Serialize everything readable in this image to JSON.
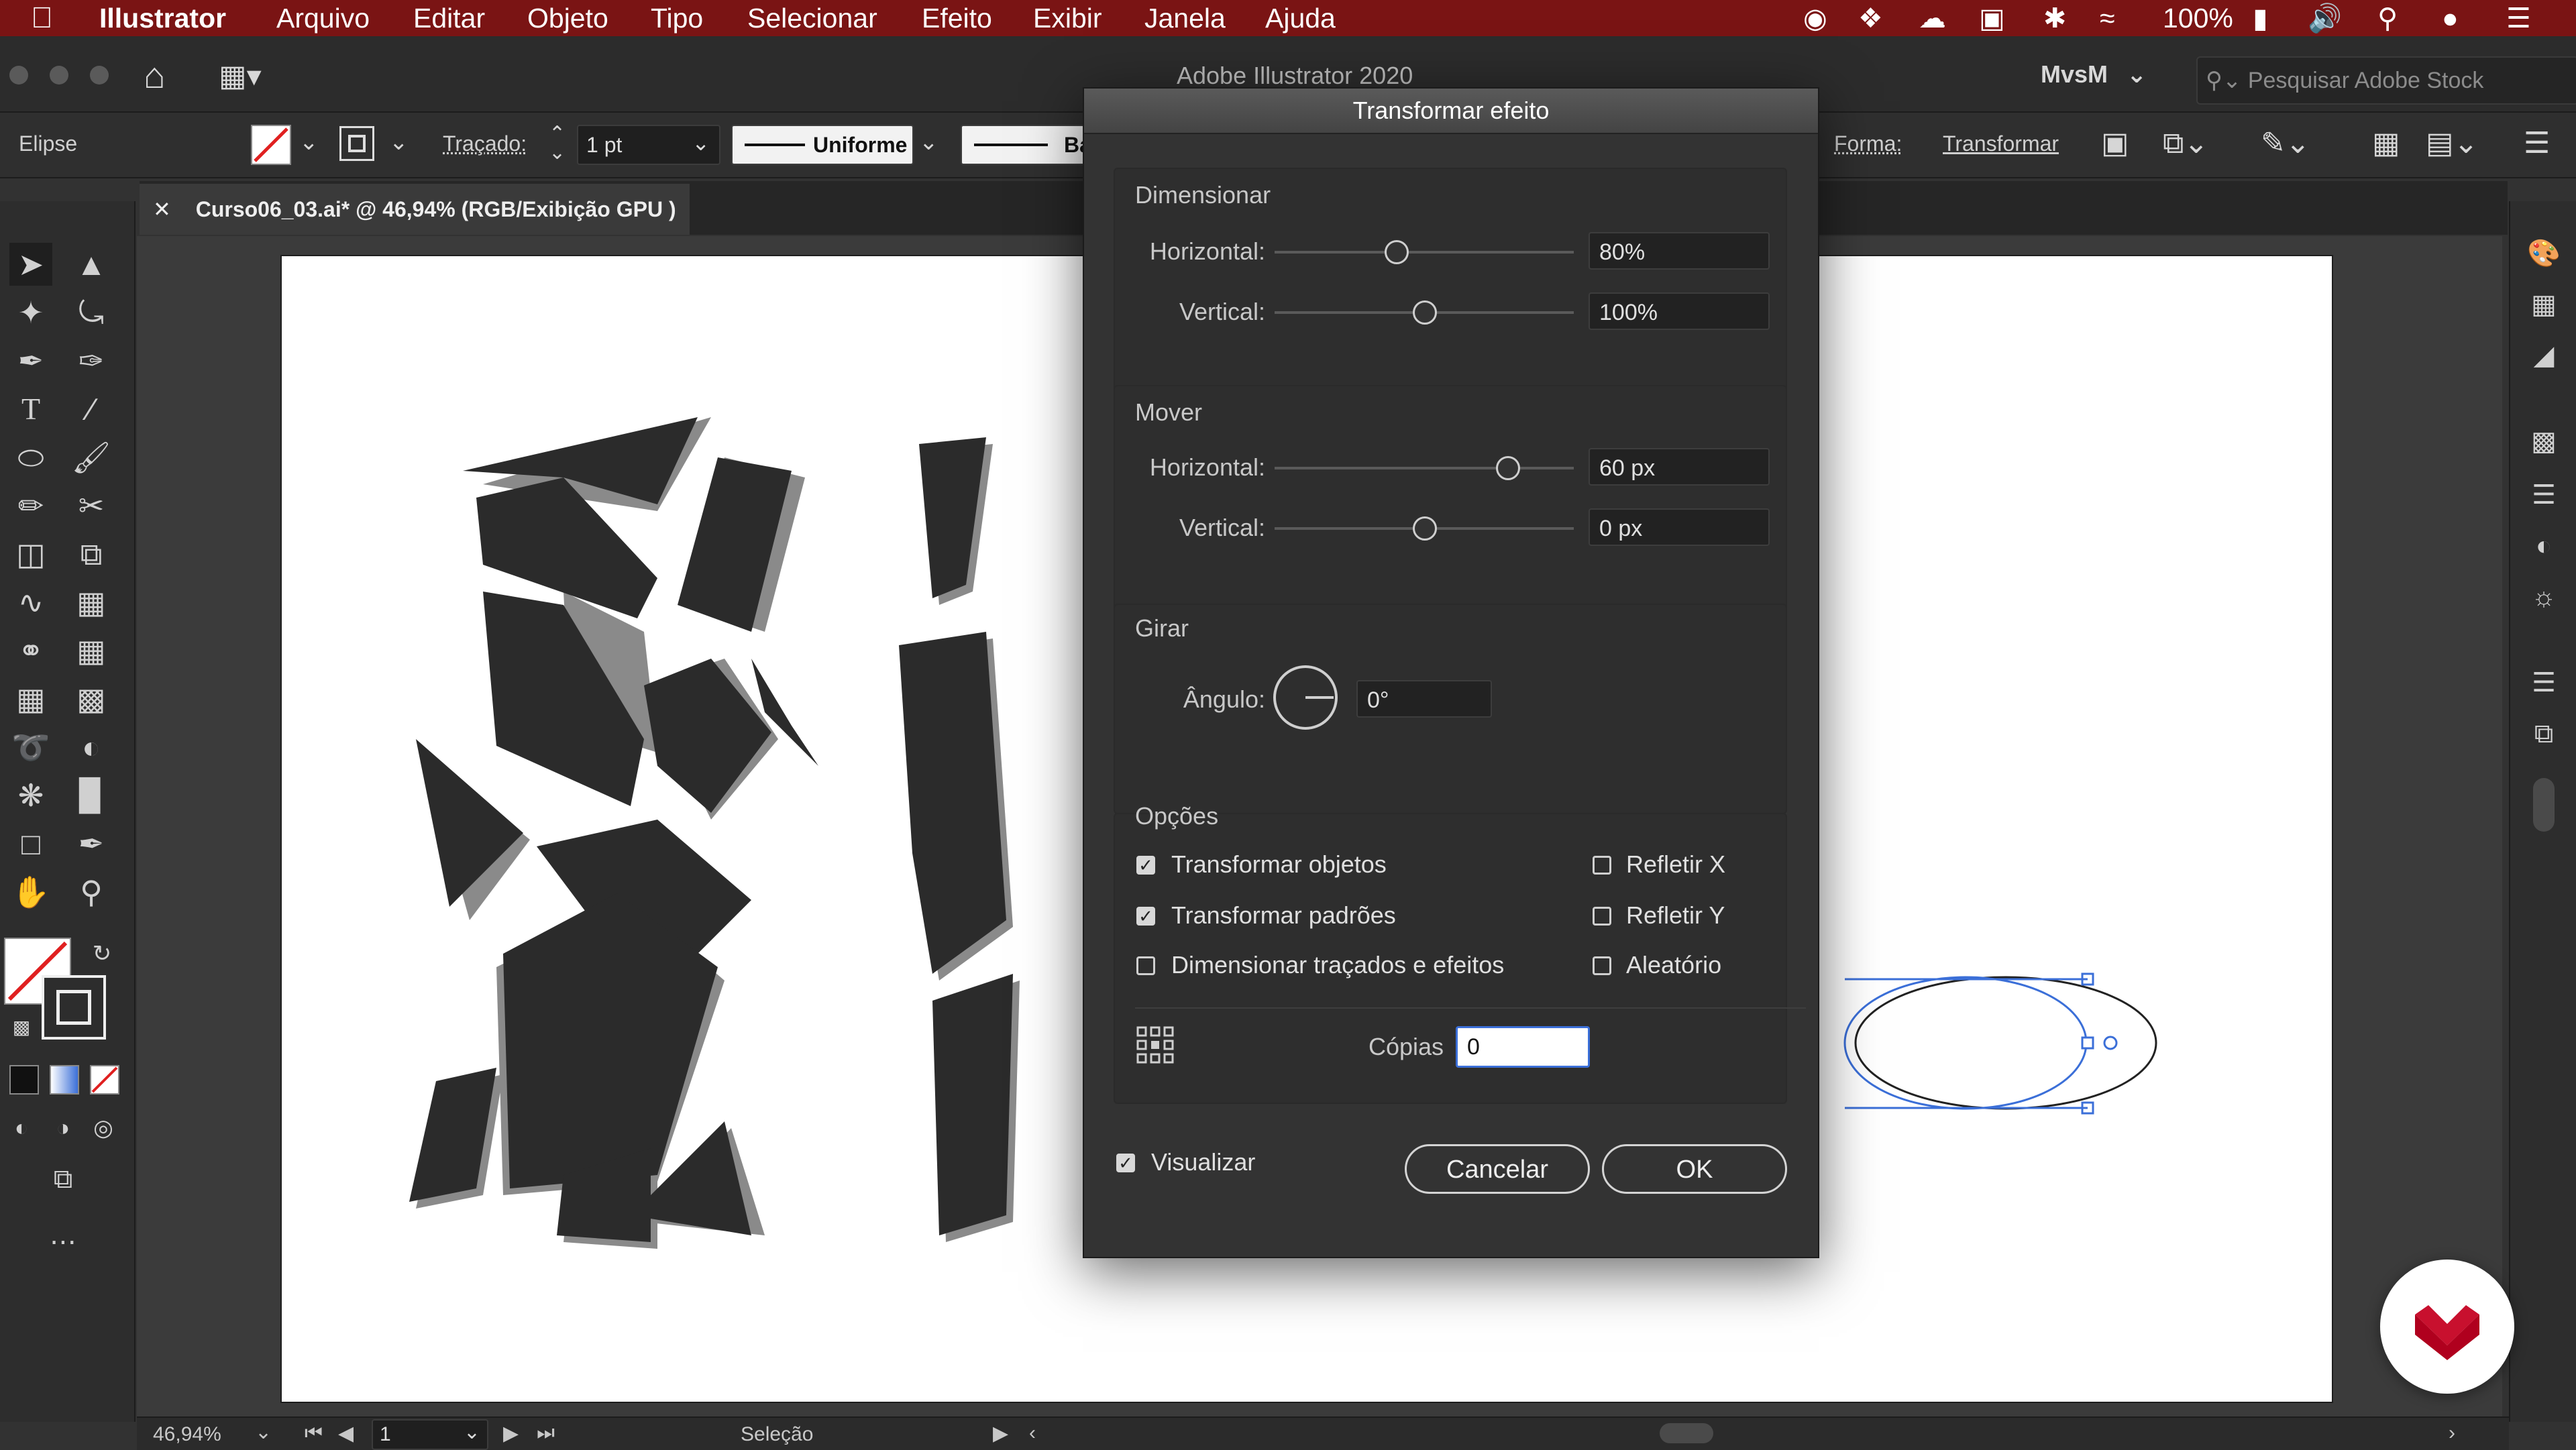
{
  "menubar": {
    "app": "Illustrator",
    "items": [
      "Arquivo",
      "Editar",
      "Objeto",
      "Tipo",
      "Selecionar",
      "Efeito",
      "Exibir",
      "Janela",
      "Ajuda"
    ],
    "battery": "100%"
  },
  "titlebar": {
    "title": "Adobe Illustrator 2020",
    "workspace": "MvsM",
    "search_placeholder": "Pesquisar Adobe Stock"
  },
  "controlbar": {
    "selection": "Elipse",
    "stroke_label": "Traçado:",
    "stroke_value": "1 pt",
    "profile": "Uniforme",
    "brush_partial": "Ba",
    "shape_label": "Forma:",
    "transform_label": "Transformar"
  },
  "document": {
    "tab_title": "Curso06_03.ai* @ 46,94% (RGB/Exibição GPU )"
  },
  "statusbar": {
    "zoom": "46,94%",
    "artboard": "1",
    "mode": "Seleção"
  },
  "dialog": {
    "title": "Transformar efeito",
    "scale": {
      "heading": "Dimensionar",
      "horizontal_label": "Horizontal:",
      "horizontal_value": "80%",
      "vertical_label": "Vertical:",
      "vertical_value": "100%"
    },
    "move": {
      "heading": "Mover",
      "horizontal_label": "Horizontal:",
      "horizontal_value": "60 px",
      "vertical_label": "Vertical:",
      "vertical_value": "0 px"
    },
    "rotate": {
      "heading": "Girar",
      "angle_label": "Ângulo:",
      "angle_value": "0°"
    },
    "options": {
      "heading": "Opções",
      "transform_objects": "Transformar objetos",
      "transform_patterns": "Transformar padrões",
      "scale_strokes": "Dimensionar traçados e efeitos",
      "reflect_x": "Refletir X",
      "reflect_y": "Refletir Y",
      "random": "Aleatório",
      "copies_label": "Cópias",
      "copies_value": "0"
    },
    "preview_label": "Visualizar",
    "cancel": "Cancelar",
    "ok": "OK"
  },
  "colors": {
    "menubar": "#7a1414",
    "shape_fill": "#2b2b2b",
    "selection_blue": "#3b6fd8",
    "logo_red": "#c8102e"
  }
}
